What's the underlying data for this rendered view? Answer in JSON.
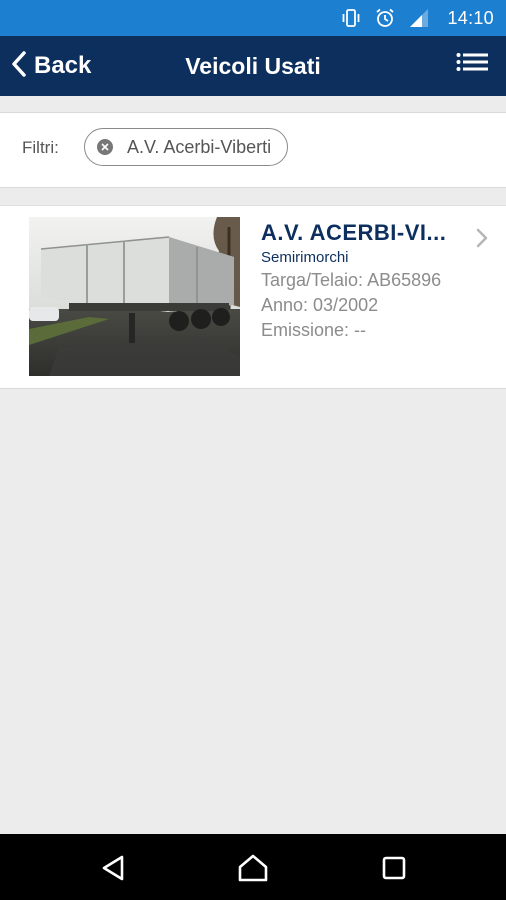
{
  "status_bar": {
    "time": "14:10",
    "icons": [
      "vibrate-icon",
      "alarm-icon",
      "signal-icon"
    ]
  },
  "app_bar": {
    "back_label": "Back",
    "title": "Veicoli Usati",
    "menu_icon": "list-menu-icon"
  },
  "filters": {
    "label": "Filtri:",
    "chips": [
      {
        "label": "A.V. Acerbi-Viberti",
        "icon": "remove-circle-icon"
      }
    ]
  },
  "vehicles": [
    {
      "name": "A.V. ACERBI-VI...",
      "category": "Semirimorchi",
      "targa": "Targa/Telaio: AB65896",
      "anno": "Anno: 03/2002",
      "emissione": "Emissione: --",
      "image": "semitrailer-photo"
    }
  ],
  "nav_bar": {
    "buttons": [
      "back-triangle-icon",
      "home-icon",
      "recents-icon"
    ]
  },
  "colors": {
    "status_bar": "#1d7fd0",
    "app_bar": "#0d2f5e",
    "background": "#ececec",
    "accent_text": "#0d2f5e"
  }
}
